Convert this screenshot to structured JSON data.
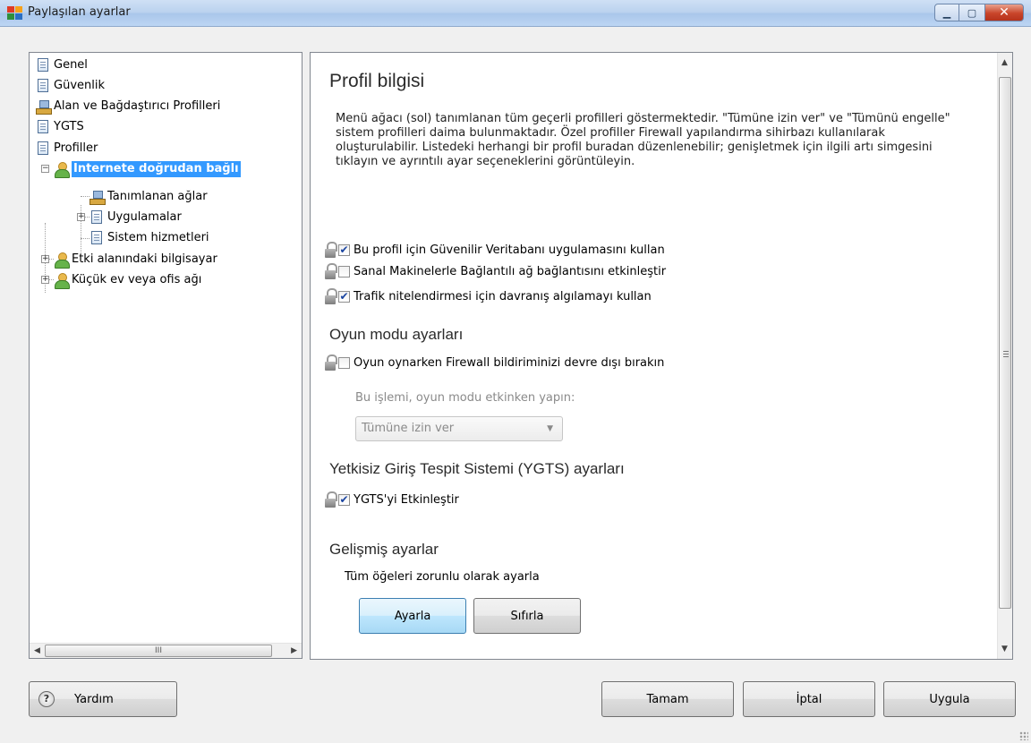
{
  "window": {
    "title": "Paylaşılan ayarlar"
  },
  "tree": {
    "items": [
      {
        "label": "Genel",
        "icon": "document-icon"
      },
      {
        "label": "Güvenlik",
        "icon": "document-icon"
      },
      {
        "label": "Alan ve Bağdaştırıcı Profilleri",
        "icon": "network-icon"
      },
      {
        "label": "YGTS",
        "icon": "document-icon"
      },
      {
        "label": "Profiller",
        "icon": "document-icon"
      },
      {
        "label": "Internete doğrudan bağlı",
        "icon": "user-icon",
        "selected": true,
        "expanded": true
      },
      {
        "label": "Tanımlanan ağlar",
        "icon": "network-icon"
      },
      {
        "label": "Uygulamalar",
        "icon": "document-icon",
        "collapsed": true
      },
      {
        "label": "Sistem hizmetleri",
        "icon": "document-icon"
      },
      {
        "label": "Etki alanındaki bilgisayar",
        "icon": "user-icon",
        "collapsed": true
      },
      {
        "label": "Küçük ev veya ofis ağı",
        "icon": "user-icon",
        "collapsed": true
      }
    ],
    "scroll_thumb": "III"
  },
  "content": {
    "title": "Profil bilgisi",
    "description": "Menü ağacı (sol) tanımlanan tüm geçerli profilleri göstermektedir. \"Tümüne izin ver\" ve \"Tümünü engelle\" sistem profilleri daima bulunmaktadır. Özel profiller Firewall yapılandırma sihirbazı kullanılarak oluşturulabilir. Listedeki herhangi bir profil buradan düzenlenebilir; genişletmek için ilgili artı simgesini tıklayın ve ayrıntılı ayar seçeneklerini görüntüleyin.",
    "options": [
      {
        "label": "Bu profil için Güvenilir Veritabanı uygulamasını kullan",
        "checked": true
      },
      {
        "label": "Sanal Makinelerle Bağlantılı ağ bağlantısını etkinleştir",
        "checked": false
      },
      {
        "label": "Trafik nitelendirmesi için davranış algılamayı kullan",
        "checked": true
      }
    ],
    "game_mode": {
      "heading": "Oyun modu ayarları",
      "option_label": "Oyun oynarken Firewall bildiriminizi devre dışı bırakın",
      "option_checked": false,
      "sub_label": "Bu işlemi, oyun modu etkinken yapın:",
      "combo_value": "Tümüne izin ver"
    },
    "ids": {
      "heading": "Yetkisiz Giriş Tespit Sistemi (YGTS) ayarları",
      "option_label": "YGTS'yi Etkinleştir",
      "option_checked": true
    },
    "advanced": {
      "heading": "Gelişmiş ayarlar",
      "text": "Tüm öğeleri zorunlu olarak ayarla",
      "set_button": "Ayarla",
      "reset_button": "Sıfırla"
    }
  },
  "footer": {
    "help_button": "Yardım",
    "ok_button": "Tamam",
    "cancel_button": "İptal",
    "apply_button": "Uygula"
  },
  "check_glyph": "✔"
}
